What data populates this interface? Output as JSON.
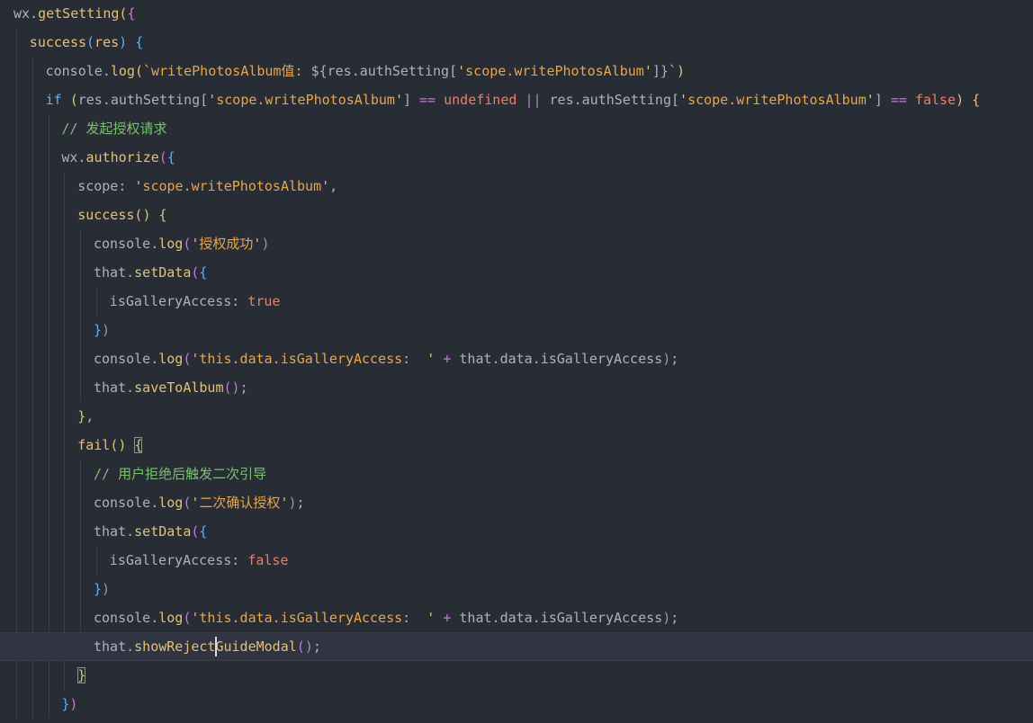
{
  "editor": {
    "colors": {
      "background": "#282c34",
      "current_line": "#2f3440",
      "identifier": "#abb2bf",
      "function": "#e5c07b",
      "keyword": "#61afef",
      "string": "#e5a64d",
      "literal": "#ef7c6a",
      "operator": "#c678dd",
      "comment": "#7bbf73"
    },
    "lines": [
      {
        "indent": 0,
        "tokens": [
          [
            "id",
            "wx"
          ],
          [
            "punc",
            "."
          ],
          [
            "fn",
            "getSetting"
          ],
          [
            "brk1",
            "("
          ],
          [
            "brk2",
            "{"
          ]
        ]
      },
      {
        "indent": 1,
        "tokens": [
          [
            "fn",
            "success"
          ],
          [
            "brk3",
            "("
          ],
          [
            "fn",
            "res"
          ],
          [
            "brk3",
            ")"
          ],
          [
            "punc",
            " "
          ],
          [
            "brk3",
            "{"
          ]
        ]
      },
      {
        "indent": 2,
        "tokens": [
          [
            "id",
            "console"
          ],
          [
            "punc",
            "."
          ],
          [
            "fn",
            "log"
          ],
          [
            "brk1",
            "("
          ],
          [
            "strchar",
            "`"
          ],
          [
            "str",
            "writePhotosAlbum值: "
          ],
          [
            "punc",
            "${"
          ],
          [
            "id",
            "res"
          ],
          [
            "punc",
            "."
          ],
          [
            "id",
            "authSetting"
          ],
          [
            "punc",
            "["
          ],
          [
            "strchar",
            "'"
          ],
          [
            "str",
            "scope.writePhotosAlbum"
          ],
          [
            "strchar",
            "'"
          ],
          [
            "punc",
            "]"
          ],
          [
            "punc",
            "}"
          ],
          [
            "strchar",
            "`"
          ],
          [
            "brk1",
            ")"
          ]
        ]
      },
      {
        "indent": 2,
        "tokens": [
          [
            "kw",
            "if"
          ],
          [
            "punc",
            " "
          ],
          [
            "brk1",
            "("
          ],
          [
            "id",
            "res"
          ],
          [
            "punc",
            "."
          ],
          [
            "id",
            "authSetting"
          ],
          [
            "punc",
            "["
          ],
          [
            "strchar",
            "'"
          ],
          [
            "str",
            "scope.writePhotosAlbum"
          ],
          [
            "strchar",
            "'"
          ],
          [
            "punc",
            "]"
          ],
          [
            "punc",
            " "
          ],
          [
            "op",
            "=="
          ],
          [
            "punc",
            " "
          ],
          [
            "lit",
            "undefined"
          ],
          [
            "punc",
            " "
          ],
          [
            "op",
            "||"
          ],
          [
            "punc",
            " "
          ],
          [
            "id",
            "res"
          ],
          [
            "punc",
            "."
          ],
          [
            "id",
            "authSetting"
          ],
          [
            "punc",
            "["
          ],
          [
            "strchar",
            "'"
          ],
          [
            "str",
            "scope.writePhotosAlbum"
          ],
          [
            "strchar",
            "'"
          ],
          [
            "punc",
            "]"
          ],
          [
            "punc",
            " "
          ],
          [
            "op",
            "=="
          ],
          [
            "punc",
            " "
          ],
          [
            "lit",
            "false"
          ],
          [
            "brk1",
            ")"
          ],
          [
            "punc",
            " "
          ],
          [
            "brk1",
            "{"
          ]
        ]
      },
      {
        "indent": 3,
        "tokens": [
          [
            "com",
            "// 发起授权请求"
          ]
        ]
      },
      {
        "indent": 3,
        "tokens": [
          [
            "id",
            "wx"
          ],
          [
            "punc",
            "."
          ],
          [
            "fn",
            "authorize"
          ],
          [
            "brk2",
            "("
          ],
          [
            "brk3",
            "{"
          ]
        ]
      },
      {
        "indent": 4,
        "tokens": [
          [
            "id",
            "scope"
          ],
          [
            "punc",
            ": "
          ],
          [
            "strchar",
            "'"
          ],
          [
            "str",
            "scope.writePhotosAlbum"
          ],
          [
            "strchar",
            "'"
          ],
          [
            "punc",
            ","
          ]
        ]
      },
      {
        "indent": 4,
        "tokens": [
          [
            "fn",
            "success"
          ],
          [
            "brk1",
            "("
          ],
          [
            "brk1",
            ")"
          ],
          [
            "punc",
            " "
          ],
          [
            "brk1",
            "{"
          ]
        ]
      },
      {
        "indent": 5,
        "tokens": [
          [
            "id",
            "console"
          ],
          [
            "punc",
            "."
          ],
          [
            "fn",
            "log"
          ],
          [
            "brk2",
            "("
          ],
          [
            "strchar",
            "'"
          ],
          [
            "str",
            "授权成功"
          ],
          [
            "strchar",
            "'"
          ],
          [
            "brk2",
            ")"
          ]
        ]
      },
      {
        "indent": 5,
        "tokens": [
          [
            "id",
            "that"
          ],
          [
            "punc",
            "."
          ],
          [
            "fn",
            "setData"
          ],
          [
            "brk2",
            "("
          ],
          [
            "brk3",
            "{"
          ]
        ]
      },
      {
        "indent": 6,
        "tokens": [
          [
            "id",
            "isGalleryAccess"
          ],
          [
            "punc",
            ": "
          ],
          [
            "lit",
            "true"
          ]
        ]
      },
      {
        "indent": 5,
        "tokens": [
          [
            "brk3",
            "}"
          ],
          [
            "brk2",
            ")"
          ]
        ]
      },
      {
        "indent": 5,
        "tokens": [
          [
            "id",
            "console"
          ],
          [
            "punc",
            "."
          ],
          [
            "fn",
            "log"
          ],
          [
            "brk2",
            "("
          ],
          [
            "strchar",
            "'"
          ],
          [
            "str",
            "this.data.isGalleryAccess:  "
          ],
          [
            "strchar",
            "'"
          ],
          [
            "punc",
            " "
          ],
          [
            "op",
            "+"
          ],
          [
            "punc",
            " "
          ],
          [
            "id",
            "that"
          ],
          [
            "punc",
            "."
          ],
          [
            "id",
            "data"
          ],
          [
            "punc",
            "."
          ],
          [
            "id",
            "isGalleryAccess"
          ],
          [
            "brk2",
            ")"
          ],
          [
            "punc",
            ";"
          ]
        ]
      },
      {
        "indent": 5,
        "tokens": [
          [
            "id",
            "that"
          ],
          [
            "punc",
            "."
          ],
          [
            "fn",
            "saveToAlbum"
          ],
          [
            "brk2",
            "("
          ],
          [
            "brk2",
            ")"
          ],
          [
            "punc",
            ";"
          ]
        ]
      },
      {
        "indent": 4,
        "tokens": [
          [
            "brk1",
            "}"
          ],
          [
            "punc",
            ","
          ]
        ]
      },
      {
        "indent": 4,
        "tokens": [
          [
            "fn",
            "fail"
          ],
          [
            "brk1",
            "("
          ],
          [
            "brk1",
            ")"
          ],
          [
            "punc",
            " "
          ],
          [
            "brk1",
            "{"
          ]
        ]
      },
      {
        "indent": 5,
        "tokens": [
          [
            "com",
            "// 用户拒绝后触发二次引导"
          ]
        ]
      },
      {
        "indent": 5,
        "tokens": [
          [
            "id",
            "console"
          ],
          [
            "punc",
            "."
          ],
          [
            "fn",
            "log"
          ],
          [
            "brk2",
            "("
          ],
          [
            "strchar",
            "'"
          ],
          [
            "str",
            "二次确认授权"
          ],
          [
            "strchar",
            "'"
          ],
          [
            "brk2",
            ")"
          ],
          [
            "punc",
            ";"
          ]
        ]
      },
      {
        "indent": 5,
        "tokens": [
          [
            "id",
            "that"
          ],
          [
            "punc",
            "."
          ],
          [
            "fn",
            "setData"
          ],
          [
            "brk2",
            "("
          ],
          [
            "brk3",
            "{"
          ]
        ]
      },
      {
        "indent": 6,
        "tokens": [
          [
            "id",
            "isGalleryAccess"
          ],
          [
            "punc",
            ": "
          ],
          [
            "lit",
            "false"
          ]
        ]
      },
      {
        "indent": 5,
        "tokens": [
          [
            "brk3",
            "}"
          ],
          [
            "brk2",
            ")"
          ]
        ]
      },
      {
        "indent": 5,
        "tokens": [
          [
            "id",
            "console"
          ],
          [
            "punc",
            "."
          ],
          [
            "fn",
            "log"
          ],
          [
            "brk2",
            "("
          ],
          [
            "strchar",
            "'"
          ],
          [
            "str",
            "this.data.isGalleryAccess:  "
          ],
          [
            "strchar",
            "'"
          ],
          [
            "punc",
            " "
          ],
          [
            "op",
            "+"
          ],
          [
            "punc",
            " "
          ],
          [
            "id",
            "that"
          ],
          [
            "punc",
            "."
          ],
          [
            "id",
            "data"
          ],
          [
            "punc",
            "."
          ],
          [
            "id",
            "isGalleryAccess"
          ],
          [
            "brk2",
            ")"
          ],
          [
            "punc",
            ";"
          ]
        ]
      },
      {
        "indent": 5,
        "current": true,
        "tokens": [
          [
            "id",
            "that"
          ],
          [
            "punc",
            "."
          ],
          [
            "fn",
            "showRejectGuideModal"
          ],
          [
            "brk2",
            "("
          ],
          [
            "brk2",
            ")"
          ],
          [
            "punc",
            ";"
          ]
        ]
      },
      {
        "indent": 4,
        "tokens": [
          [
            "brk1",
            "}"
          ]
        ]
      },
      {
        "indent": 3,
        "tokens": [
          [
            "brk3",
            "}"
          ],
          [
            "brk2",
            ")"
          ]
        ]
      }
    ]
  }
}
